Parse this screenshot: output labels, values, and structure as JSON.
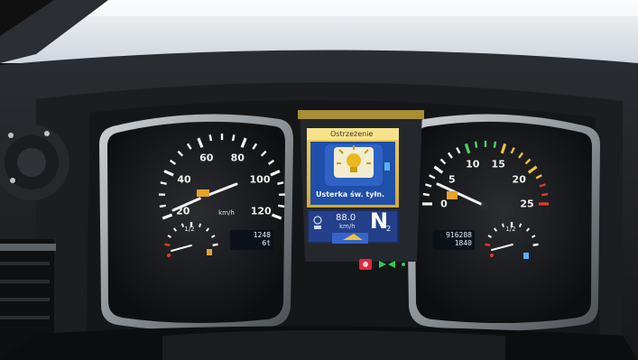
{
  "speedometer": {
    "ticks": [
      "20",
      "40",
      "60",
      "80",
      "100",
      "120"
    ],
    "unit": "km/h",
    "fuel_half": "1/2",
    "odometer_lines": [
      "1248",
      "6t"
    ]
  },
  "tachometer": {
    "ticks": [
      "0",
      "5",
      "10",
      "15",
      "20",
      "25"
    ],
    "half": "1/2",
    "odometer_lines": [
      "916288",
      "1840"
    ]
  },
  "center_display": {
    "header": "Ostrzeżenie",
    "warning_text": "Usterka św. tyłn.",
    "speed_value": "88.0",
    "speed_unit": "km/h",
    "gear": "N",
    "gear_sub": "2"
  },
  "colors": {
    "display_yellow": "#e8c84a",
    "display_blue": "#2a57b0",
    "needle": "#f4f4f4",
    "redline": "#e03a2a",
    "indicator_red": "#e0283c",
    "indicator_green": "#2ecc55"
  }
}
